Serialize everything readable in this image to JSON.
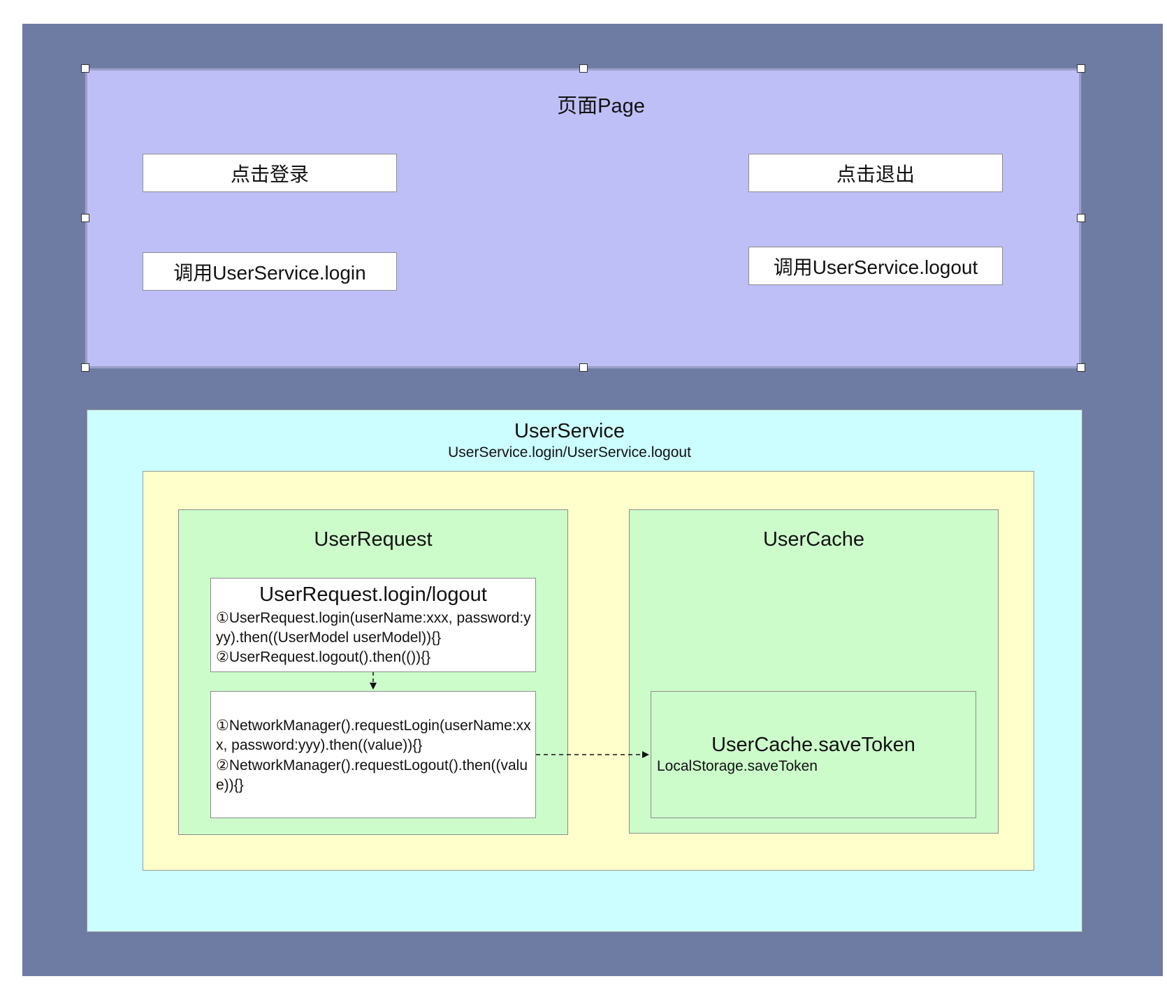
{
  "page": {
    "title": "页面Page",
    "login_button": "点击登录",
    "logout_button": "点击退出",
    "login_call": "调用UserService.login",
    "logout_call": "调用UserService.logout"
  },
  "user_service": {
    "title": "UserService",
    "subtitle": "UserService.login/UserService.logout"
  },
  "user_request": {
    "title": "UserRequest",
    "api_box": {
      "title": "UserRequest.login/logout",
      "line1": "①UserRequest.login(userName:xxx, password:yyy).then((UserModel userModel)){}",
      "line2": "②UserRequest.logout().then(()){}"
    },
    "network_box": {
      "line1": "①NetworkManager().requestLogin(userName:xxx, password:yyy).then((value)){}",
      "line2": "②NetworkManager().requestLogout().then((value)){}"
    }
  },
  "user_cache": {
    "title": "UserCache",
    "save_box": {
      "title": "UserCache.saveToken",
      "subtitle": "LocalStorage.saveToken"
    }
  },
  "colors": {
    "outer": "#6e7ba2",
    "page": "#bfbff7",
    "service": "#ccfdff",
    "module": "#ffffcc",
    "component": "#ccfcca"
  }
}
